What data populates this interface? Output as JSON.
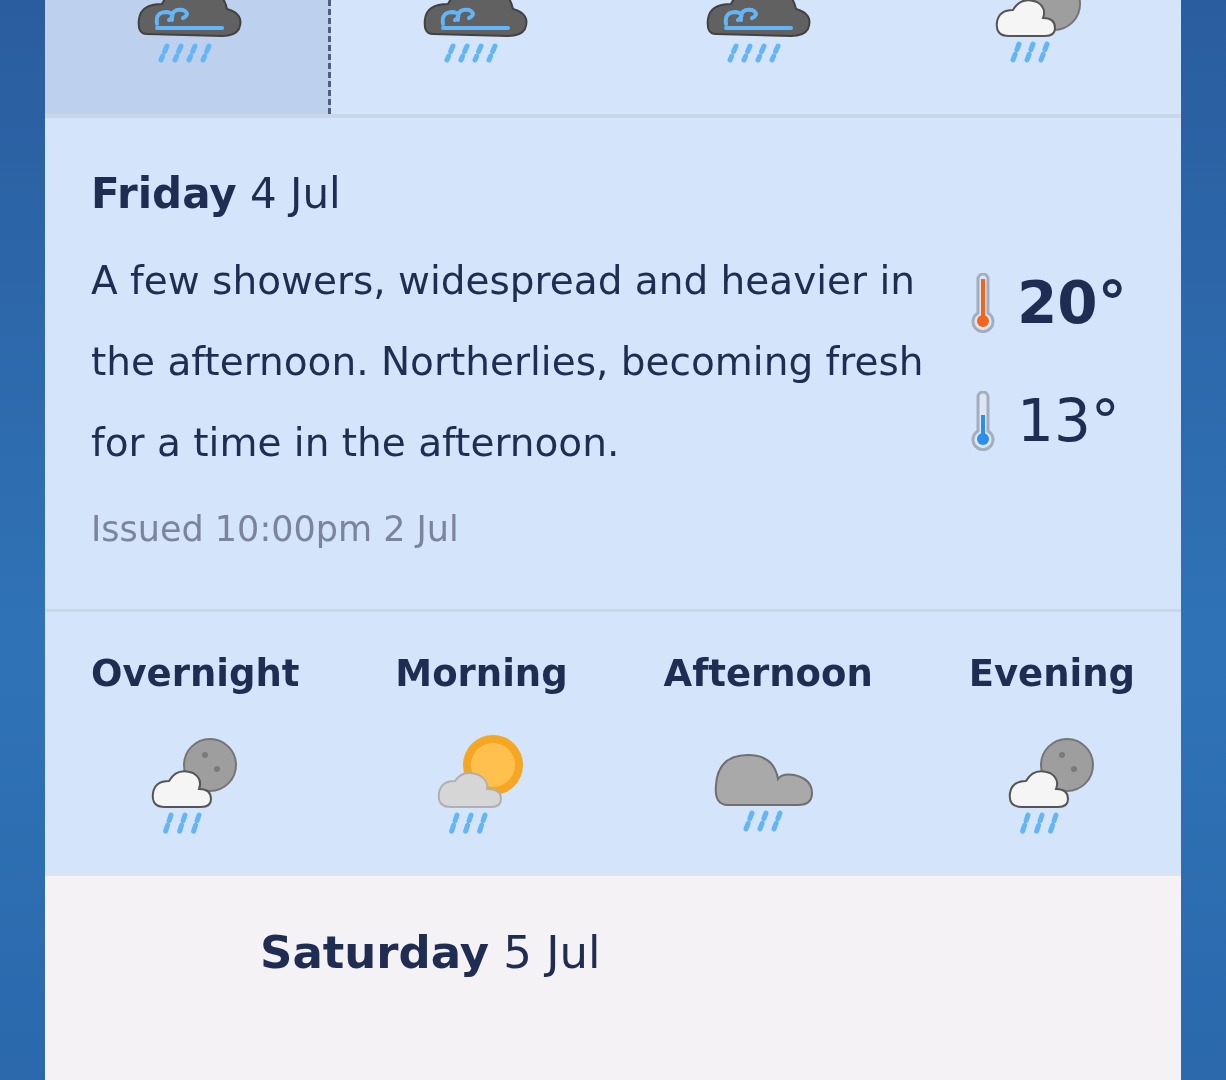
{
  "time_slots": [
    {
      "kind": "wind-rain",
      "selected": true
    },
    {
      "kind": "wind-rain",
      "selected": false
    },
    {
      "kind": "wind-rain",
      "selected": false
    },
    {
      "kind": "night-cloud-rain",
      "selected": false
    }
  ],
  "forecast": {
    "heading": "**Friday** 4 Jul",
    "summary": "A few showers, widespread and heavier in the afternoon. Northerlies, becoming fresh for a time in the afternoon.",
    "issued": "Issued 10:00pm 2 Jul",
    "temperatures": [
      {
        "kind": "max",
        "value": "20°"
      },
      {
        "kind": "min",
        "value": "13°"
      }
    ]
  },
  "periods": [
    {
      "label": "Overnight",
      "kind": "night-cloud-rain"
    },
    {
      "label": "Morning",
      "kind": "sun-cloud-rain"
    },
    {
      "label": "Afternoon",
      "kind": "cloud-rain"
    },
    {
      "label": "Evening",
      "kind": "night-cloud-rain"
    }
  ],
  "next_day": {
    "heading": "**Saturday** 5 Jul"
  }
}
